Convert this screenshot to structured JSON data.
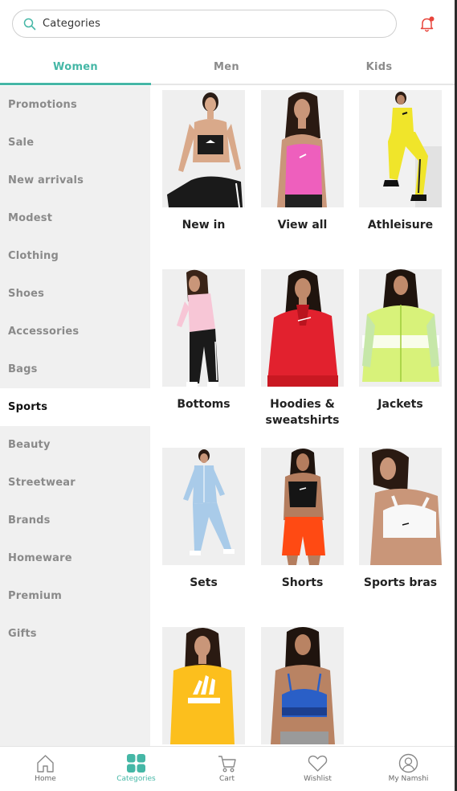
{
  "search": {
    "placeholder": "Categories"
  },
  "tabs": [
    {
      "label": "Women",
      "active": true
    },
    {
      "label": "Men",
      "active": false
    },
    {
      "label": "Kids",
      "active": false
    }
  ],
  "sidebar": {
    "items": [
      {
        "label": "Promotions"
      },
      {
        "label": "Sale"
      },
      {
        "label": "New arrivals"
      },
      {
        "label": "Modest"
      },
      {
        "label": "Clothing"
      },
      {
        "label": "Shoes"
      },
      {
        "label": "Accessories"
      },
      {
        "label": "Bags"
      },
      {
        "label": "Sports",
        "active": true
      },
      {
        "label": "Beauty"
      },
      {
        "label": "Streetwear"
      },
      {
        "label": "Brands"
      },
      {
        "label": "Homeware"
      },
      {
        "label": "Premium"
      },
      {
        "label": "Gifts"
      }
    ]
  },
  "tiles": [
    {
      "label": "New in"
    },
    {
      "label": "View all"
    },
    {
      "label": "Athleisure"
    },
    {
      "label": "Bottoms"
    },
    {
      "label": "Hoodies & sweatshirts"
    },
    {
      "label": "Jackets"
    },
    {
      "label": "Sets"
    },
    {
      "label": "Shorts"
    },
    {
      "label": "Sports bras"
    },
    {
      "label": ""
    },
    {
      "label": ""
    }
  ],
  "bottom_nav": [
    {
      "label": "Home",
      "icon": "home-icon"
    },
    {
      "label": "Categories",
      "icon": "grid-icon",
      "active": true
    },
    {
      "label": "Cart",
      "icon": "cart-icon"
    },
    {
      "label": "Wishlist",
      "icon": "heart-icon"
    },
    {
      "label": "My Namshi",
      "icon": "user-icon"
    }
  ],
  "colors": {
    "accent": "#45b7a6",
    "notification": "#e8453c",
    "sidebar_bg": "#f0f0f0"
  }
}
